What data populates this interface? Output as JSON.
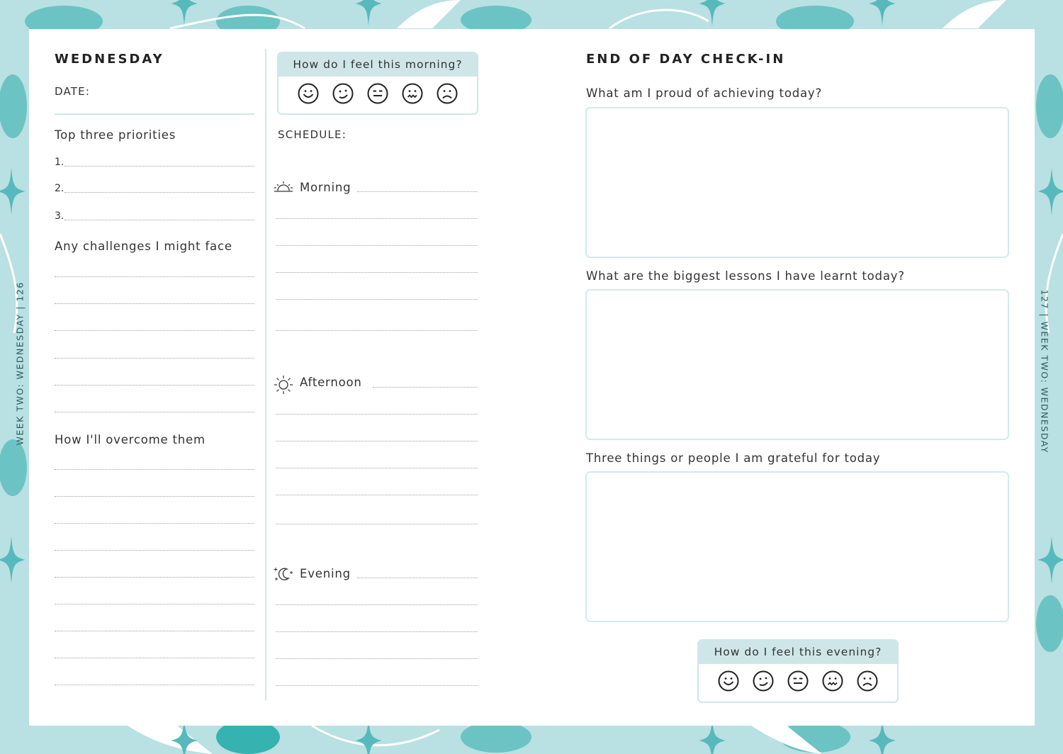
{
  "left_page": {
    "title": "WEDNESDAY",
    "date_label": "DATE:",
    "priorities_label": "Top three priorities",
    "priority_numbers": [
      "1.",
      "2.",
      "3."
    ],
    "challenges_label": "Any challenges I might face",
    "overcome_label": "How I'll overcome them",
    "side_label": "WEEK TWO: WEDNESDAY | 126"
  },
  "morning_mood": {
    "question": "How do I feel this morning?",
    "faces": [
      "very-happy-face-icon",
      "happy-face-icon",
      "neutral-face-icon",
      "worried-face-icon",
      "sad-face-icon"
    ]
  },
  "schedule": {
    "label": "SCHEDULE:",
    "morning": "Morning",
    "afternoon": "Afternoon",
    "evening": "Evening"
  },
  "right_page": {
    "title": "END OF DAY CHECK-IN",
    "q1": "What am I proud of achieving today?",
    "q2": "What are the biggest lessons I have learnt today?",
    "q3": "Three things or people I am grateful for today",
    "side_label": "127 | WEEK TWO: WEDNESDAY"
  },
  "evening_mood": {
    "question": "How do I feel this evening?",
    "faces": [
      "very-happy-face-icon",
      "happy-face-icon",
      "neutral-face-icon",
      "worried-face-icon",
      "sad-face-icon"
    ]
  },
  "colors": {
    "background": "#b9e0e2",
    "accent": "#cfe6e8",
    "pattern_teal": "#5fbcbd",
    "pattern_white": "#ffffff"
  }
}
